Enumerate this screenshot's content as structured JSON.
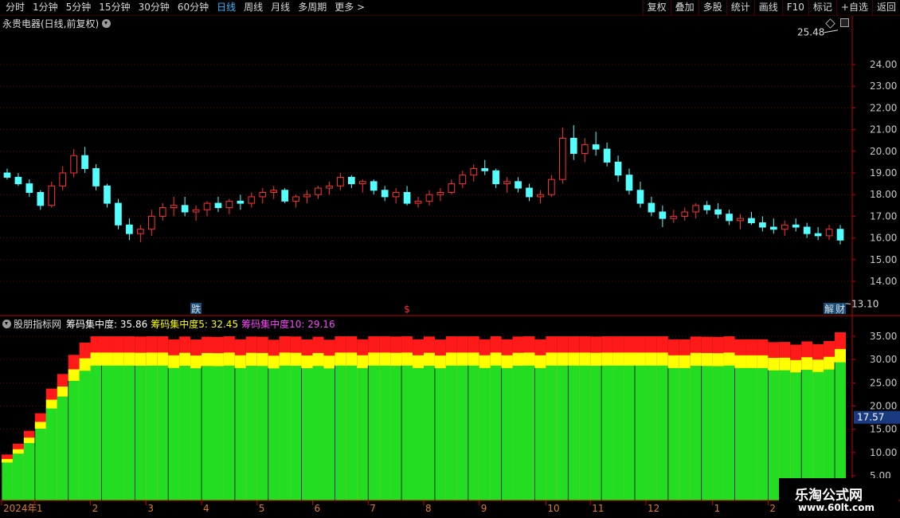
{
  "toolbar": {
    "periods": [
      {
        "label": "分时",
        "active": false
      },
      {
        "label": "1分钟",
        "active": false
      },
      {
        "label": "5分钟",
        "active": false
      },
      {
        "label": "15分钟",
        "active": false
      },
      {
        "label": "30分钟",
        "active": false
      },
      {
        "label": "60分钟",
        "active": false
      },
      {
        "label": "日线",
        "active": true
      },
      {
        "label": "周线",
        "active": false
      },
      {
        "label": "月线",
        "active": false
      },
      {
        "label": "多周期",
        "active": false
      },
      {
        "label": "更多 >",
        "active": false
      }
    ],
    "actions": [
      "复权",
      "叠加",
      "多股",
      "统计",
      "画线",
      "F10",
      "标记",
      "+自选",
      "返回"
    ]
  },
  "stock_title": "永贵电器(日线,前复权)",
  "main_chart": {
    "y_ticks": [
      "24.00",
      "23.00",
      "22.00",
      "21.00",
      "20.00",
      "19.00",
      "18.00",
      "17.00",
      "16.00",
      "15.00",
      "14.00"
    ],
    "y_tick_values": [
      24,
      23,
      22,
      21,
      20,
      19,
      18,
      17,
      16,
      15,
      14
    ],
    "high_label": "25.48",
    "low_label": "13.10",
    "markers": [
      {
        "text": "跌",
        "index": 17
      },
      {
        "text": "$",
        "index": 36
      },
      {
        "text": "解",
        "index": 74
      },
      {
        "text": "财",
        "index": 107
      }
    ],
    "colors": {
      "up": "#ff3232",
      "down": "#54ffff",
      "grid": "#6a0000",
      "axis": "#c00000"
    }
  },
  "indicator": {
    "name": "股朋指标网",
    "series1_text": "筹码集中度: 35.86",
    "series2_text": "筹码集中度5: 32.45",
    "series3_text": "筹码集中度10: 29.16",
    "y_ticks": [
      "35.00",
      "30.00",
      "25.00",
      "20.00",
      "15.00",
      "10.00",
      "5.00"
    ],
    "y_tick_values": [
      35,
      30,
      25,
      20,
      15,
      10,
      5
    ],
    "cross_value": "17.57",
    "colors": {
      "base": "#22dd22",
      "yellow": "#ffff00",
      "red": "#ff1a1a"
    }
  },
  "time_axis": {
    "labels": [
      {
        "text": "2024年",
        "index": 0
      },
      {
        "text": "1",
        "index": 3
      },
      {
        "text": "2",
        "index": 8
      },
      {
        "text": "3",
        "index": 13
      },
      {
        "text": "4",
        "index": 18
      },
      {
        "text": "5",
        "index": 23
      },
      {
        "text": "6",
        "index": 28
      },
      {
        "text": "7",
        "index": 33
      },
      {
        "text": "8",
        "index": 38
      },
      {
        "text": "9",
        "index": 43
      },
      {
        "text": "10",
        "index": 49
      },
      {
        "text": "11",
        "index": 53
      },
      {
        "text": "12",
        "index": 58
      },
      {
        "text": "1",
        "index": 64
      },
      {
        "text": "2",
        "index": 69
      },
      {
        "text": "3",
        "index": 74
      }
    ]
  },
  "chart_data": {
    "type": "candlestick",
    "candles": [
      [
        19.0,
        19.2,
        18.7,
        18.8
      ],
      [
        18.8,
        19.0,
        18.4,
        18.5
      ],
      [
        18.5,
        18.7,
        17.9,
        18.1
      ],
      [
        18.1,
        18.2,
        17.3,
        17.5
      ],
      [
        17.5,
        18.6,
        17.4,
        18.4
      ],
      [
        18.4,
        19.3,
        18.2,
        19.0
      ],
      [
        19.0,
        20.1,
        18.8,
        19.8
      ],
      [
        19.8,
        20.2,
        19.0,
        19.2
      ],
      [
        19.2,
        19.4,
        18.2,
        18.4
      ],
      [
        18.4,
        18.5,
        17.4,
        17.6
      ],
      [
        17.6,
        17.8,
        16.4,
        16.6
      ],
      [
        16.6,
        16.9,
        15.9,
        16.2
      ],
      [
        16.2,
        16.6,
        15.8,
        16.4
      ],
      [
        16.4,
        17.3,
        16.1,
        17.0
      ],
      [
        17.0,
        17.6,
        16.8,
        17.4
      ],
      [
        17.4,
        17.9,
        17.0,
        17.5
      ],
      [
        17.5,
        17.9,
        17.0,
        17.2
      ],
      [
        17.2,
        17.5,
        16.8,
        17.3
      ],
      [
        17.3,
        17.7,
        17.0,
        17.6
      ],
      [
        17.6,
        17.9,
        17.2,
        17.4
      ],
      [
        17.4,
        17.8,
        17.1,
        17.7
      ],
      [
        17.7,
        18.0,
        17.3,
        17.6
      ],
      [
        17.6,
        18.1,
        17.4,
        17.9
      ],
      [
        17.9,
        18.3,
        17.6,
        18.1
      ],
      [
        18.1,
        18.4,
        17.8,
        18.2
      ],
      [
        18.2,
        18.3,
        17.6,
        17.7
      ],
      [
        17.7,
        18.0,
        17.4,
        17.9
      ],
      [
        17.9,
        18.2,
        17.6,
        18.0
      ],
      [
        18.0,
        18.4,
        17.8,
        18.3
      ],
      [
        18.3,
        18.6,
        18.0,
        18.4
      ],
      [
        18.4,
        19.0,
        18.2,
        18.8
      ],
      [
        18.8,
        18.9,
        18.3,
        18.5
      ],
      [
        18.5,
        18.7,
        18.1,
        18.6
      ],
      [
        18.6,
        18.7,
        18.0,
        18.2
      ],
      [
        18.2,
        18.4,
        17.7,
        17.9
      ],
      [
        17.9,
        18.3,
        17.6,
        18.1
      ],
      [
        18.1,
        18.4,
        17.5,
        17.6
      ],
      [
        17.6,
        17.9,
        17.4,
        17.7
      ],
      [
        17.7,
        18.2,
        17.5,
        18.0
      ],
      [
        18.0,
        18.3,
        17.7,
        18.1
      ],
      [
        18.1,
        18.7,
        18.0,
        18.5
      ],
      [
        18.5,
        19.1,
        18.3,
        18.9
      ],
      [
        18.9,
        19.4,
        18.6,
        19.2
      ],
      [
        19.2,
        19.6,
        18.9,
        19.1
      ],
      [
        19.1,
        19.2,
        18.3,
        18.5
      ],
      [
        18.5,
        18.8,
        18.1,
        18.6
      ],
      [
        18.6,
        18.8,
        18.1,
        18.3
      ],
      [
        18.3,
        18.5,
        17.7,
        17.9
      ],
      [
        17.9,
        18.2,
        17.6,
        18.0
      ],
      [
        18.0,
        18.9,
        17.9,
        18.7
      ],
      [
        18.7,
        21.1,
        18.5,
        20.6
      ],
      [
        20.6,
        21.2,
        19.6,
        19.9
      ],
      [
        19.9,
        20.6,
        19.5,
        20.3
      ],
      [
        20.3,
        20.9,
        19.8,
        20.1
      ],
      [
        20.1,
        20.4,
        19.3,
        19.5
      ],
      [
        19.5,
        19.8,
        18.6,
        18.9
      ],
      [
        18.9,
        19.2,
        18.0,
        18.2
      ],
      [
        18.2,
        18.6,
        17.4,
        17.6
      ],
      [
        17.6,
        17.9,
        17.0,
        17.2
      ],
      [
        17.2,
        17.5,
        16.5,
        16.9
      ],
      [
        16.9,
        17.3,
        16.7,
        17.0
      ],
      [
        17.0,
        17.4,
        16.8,
        17.2
      ],
      [
        17.2,
        17.6,
        16.9,
        17.5
      ],
      [
        17.5,
        17.7,
        17.1,
        17.3
      ],
      [
        17.3,
        17.6,
        16.9,
        17.1
      ],
      [
        17.1,
        17.3,
        16.6,
        16.8
      ],
      [
        16.8,
        17.1,
        16.4,
        16.9
      ],
      [
        16.9,
        17.2,
        16.6,
        16.7
      ],
      [
        16.7,
        17.0,
        16.3,
        16.5
      ],
      [
        16.5,
        16.9,
        16.2,
        16.4
      ],
      [
        16.4,
        16.8,
        16.1,
        16.6
      ],
      [
        16.6,
        16.9,
        16.3,
        16.5
      ],
      [
        16.5,
        16.7,
        16.0,
        16.2
      ],
      [
        16.2,
        16.5,
        15.9,
        16.1
      ],
      [
        16.1,
        16.6,
        15.9,
        16.4
      ],
      [
        16.4,
        16.6,
        15.7,
        15.9
      ]
    ]
  }
}
